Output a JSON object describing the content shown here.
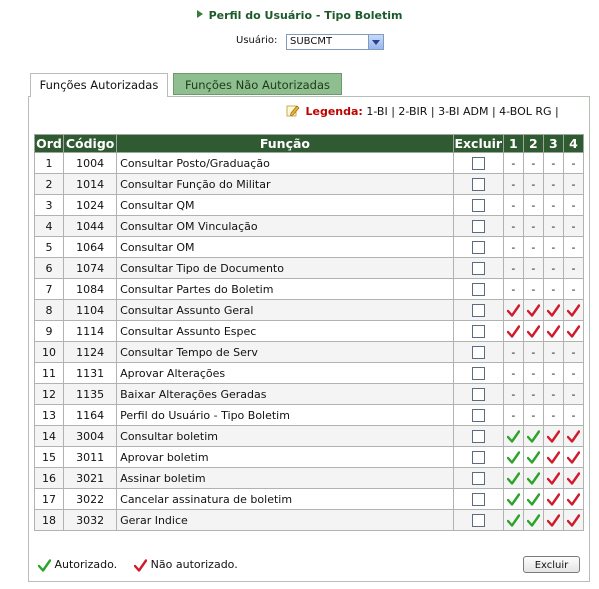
{
  "header": {
    "title": "Perfil do Usuário - Tipo Boletim"
  },
  "usuario": {
    "label": "Usuário:",
    "value": "SUBCMT"
  },
  "tabs": [
    {
      "label": "Funções Autorizadas",
      "active": true
    },
    {
      "label": "Funções Não Autorizadas",
      "active": false
    }
  ],
  "legend": {
    "label": "Legenda:",
    "items": "1-BI | 2-BIR | 3-BI ADM | 4-BOL RG |"
  },
  "table": {
    "headers": {
      "ord": "Ord",
      "codigo": "Código",
      "funcao": "Função",
      "excluir": "Excluir",
      "c1": "1",
      "c2": "2",
      "c3": "3",
      "c4": "4"
    },
    "rows": [
      {
        "ord": "1",
        "codigo": "1004",
        "funcao": "Consultar Posto/Graduação",
        "marks": [
          "-",
          "-",
          "-",
          "-"
        ]
      },
      {
        "ord": "2",
        "codigo": "1014",
        "funcao": "Consultar Função do Militar",
        "marks": [
          "-",
          "-",
          "-",
          "-"
        ]
      },
      {
        "ord": "3",
        "codigo": "1024",
        "funcao": "Consultar QM",
        "marks": [
          "-",
          "-",
          "-",
          "-"
        ]
      },
      {
        "ord": "4",
        "codigo": "1044",
        "funcao": "Consultar OM Vinculação",
        "marks": [
          "-",
          "-",
          "-",
          "-"
        ]
      },
      {
        "ord": "5",
        "codigo": "1064",
        "funcao": "Consultar OM",
        "marks": [
          "-",
          "-",
          "-",
          "-"
        ]
      },
      {
        "ord": "6",
        "codigo": "1074",
        "funcao": "Consultar Tipo de Documento",
        "marks": [
          "-",
          "-",
          "-",
          "-"
        ]
      },
      {
        "ord": "7",
        "codigo": "1084",
        "funcao": "Consultar Partes do Boletim",
        "marks": [
          "-",
          "-",
          "-",
          "-"
        ]
      },
      {
        "ord": "8",
        "codigo": "1104",
        "funcao": "Consultar Assunto Geral",
        "marks": [
          "N",
          "N",
          "N",
          "N"
        ]
      },
      {
        "ord": "9",
        "codigo": "1114",
        "funcao": "Consultar Assunto Espec",
        "marks": [
          "N",
          "N",
          "N",
          "N"
        ]
      },
      {
        "ord": "10",
        "codigo": "1124",
        "funcao": "Consultar Tempo de Serv",
        "marks": [
          "-",
          "-",
          "-",
          "-"
        ]
      },
      {
        "ord": "11",
        "codigo": "1131",
        "funcao": "Aprovar Alterações",
        "marks": [
          "-",
          "-",
          "-",
          "-"
        ]
      },
      {
        "ord": "12",
        "codigo": "1135",
        "funcao": "Baixar Alterações Geradas",
        "marks": [
          "-",
          "-",
          "-",
          "-"
        ]
      },
      {
        "ord": "13",
        "codigo": "1164",
        "funcao": "Perfil do Usuário - Tipo Boletim",
        "marks": [
          "-",
          "-",
          "-",
          "-"
        ]
      },
      {
        "ord": "14",
        "codigo": "3004",
        "funcao": "Consultar boletim",
        "marks": [
          "A",
          "A",
          "N",
          "N"
        ]
      },
      {
        "ord": "15",
        "codigo": "3011",
        "funcao": "Aprovar boletim",
        "marks": [
          "A",
          "A",
          "N",
          "N"
        ]
      },
      {
        "ord": "16",
        "codigo": "3021",
        "funcao": "Assinar boletim",
        "marks": [
          "A",
          "A",
          "N",
          "N"
        ]
      },
      {
        "ord": "17",
        "codigo": "3022",
        "funcao": "Cancelar assinatura de boletim",
        "marks": [
          "A",
          "A",
          "N",
          "N"
        ]
      },
      {
        "ord": "18",
        "codigo": "3032",
        "funcao": "Gerar Indice",
        "marks": [
          "A",
          "A",
          "N",
          "N"
        ]
      }
    ]
  },
  "footer": {
    "autorizado": "Autorizado.",
    "nao_autorizado": "Não autorizado.",
    "excluir_button": "Excluir"
  },
  "colors": {
    "header_bg": "#2f5a32",
    "authorized": "#2aa52a",
    "not_authorized": "#d11a2a",
    "legend_label": "#c00000"
  },
  "icons": {
    "pencil": "pencil-icon",
    "authorized": "green-check-icon",
    "not_authorized": "red-check-icon"
  }
}
